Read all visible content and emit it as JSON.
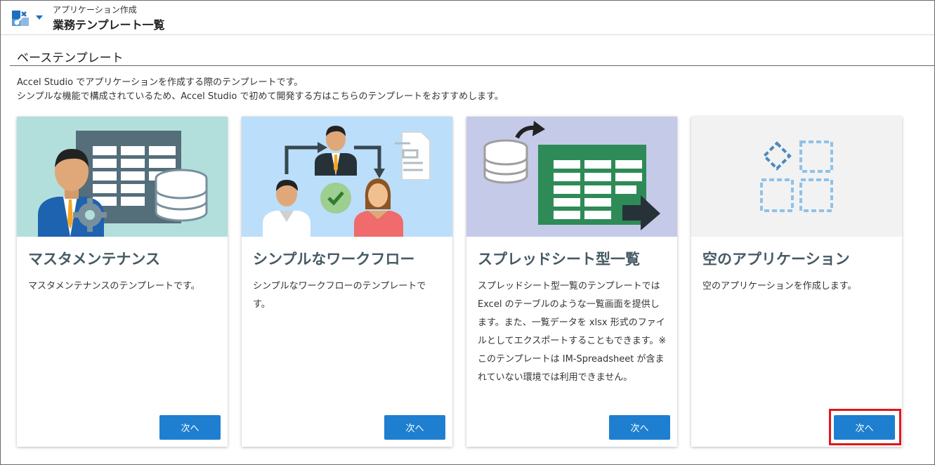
{
  "header": {
    "breadcrumb": "アプリケーション作成",
    "title": "業務テンプレート一覧",
    "app_icon": "app-settings-icon",
    "dropdown_icon": "caret-down-icon"
  },
  "section": {
    "title": "ベーステンプレート",
    "description_line1": "Accel Studio でアプリケーションを作成する際のテンプレートです。",
    "description_line2": "シンプルな機能で構成されているため、Accel Studio で初めて開発する方はこちらのテンプレートをおすすめします。"
  },
  "cards": [
    {
      "title": "マスタメンテナンス",
      "description": "マスタメンテナンスのテンプレートです。",
      "button_label": "次へ",
      "image_icon": "master-maintenance-illustration",
      "image_bg": "#b2dfdb"
    },
    {
      "title": "シンプルなワークフロー",
      "description": "シンプルなワークフローのテンプレートです。",
      "button_label": "次へ",
      "image_icon": "workflow-illustration",
      "image_bg": "#bbdefb"
    },
    {
      "title": "スプレッドシート型一覧",
      "description": "スプレッドシート型一覧のテンプレートでは Excel のテーブルのような一覧画面を提供します。また、一覧データを xlsx 形式のファイルとしてエクスポートすることもできます。※このテンプレートは IM-Spreadsheet が含まれていない環境では利用できません。",
      "button_label": "次へ",
      "image_icon": "spreadsheet-illustration",
      "image_bg": "#c5cae9"
    },
    {
      "title": "空のアプリケーション",
      "description": "空のアプリケーションを作成します。",
      "button_label": "次へ",
      "image_icon": "empty-app-illustration",
      "image_bg": "#f2f2f2"
    }
  ],
  "colors": {
    "button": "#1e7fd0",
    "card_title": "#455a64",
    "highlight": "#e3151a"
  }
}
